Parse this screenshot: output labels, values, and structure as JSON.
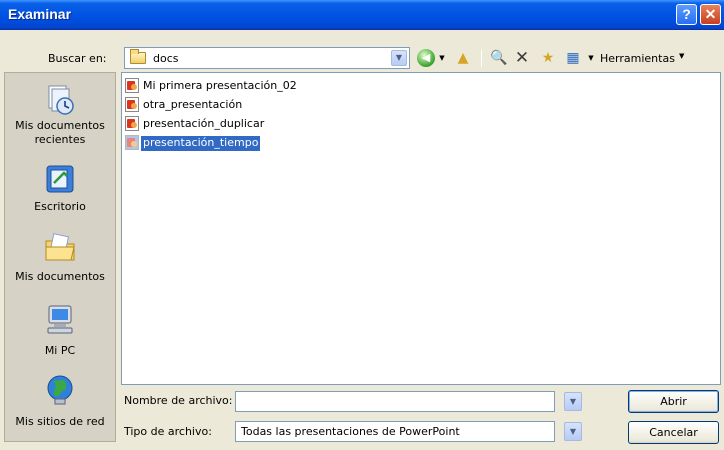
{
  "window": {
    "title": "Examinar",
    "help_glyph": "?",
    "close_glyph": "✕"
  },
  "toolbar": {
    "look_in_label": "Buscar en:",
    "look_in_value": "docs",
    "combo_arrow": "▼",
    "back_glyph": "◀",
    "dropdown_glyph": "▼",
    "up_glyph": "▲",
    "search_glyph": "🔍",
    "delete_glyph": "✕",
    "new_folder_glyph": "★",
    "views_glyph": "▦",
    "tools_label": "Herramientas"
  },
  "places": [
    {
      "label": "Mis documentos recientes",
      "icon": "recent-documents-icon"
    },
    {
      "label": "Escritorio",
      "icon": "desktop-icon"
    },
    {
      "label": "Mis documentos",
      "icon": "my-documents-icon"
    },
    {
      "label": "Mi PC",
      "icon": "my-computer-icon"
    },
    {
      "label": "Mis sitios de red",
      "icon": "network-places-icon"
    }
  ],
  "files": [
    {
      "name": "Mi primera presentación_02",
      "selected": false
    },
    {
      "name": "otra_presentación",
      "selected": false
    },
    {
      "name": "presentación_duplicar",
      "selected": false
    },
    {
      "name": "presentación_tiempo",
      "selected": true
    }
  ],
  "form": {
    "filename_label": "Nombre de archivo:",
    "filename_value": "",
    "filetype_label": "Tipo de archivo:",
    "filetype_value": "Todas las presentaciones de PowerPoint",
    "open_button": "Abrir",
    "cancel_button": "Cancelar"
  },
  "colors": {
    "titlebar": "#0054e3",
    "selection": "#316ac5",
    "dialog_bg": "#ece9d8"
  }
}
